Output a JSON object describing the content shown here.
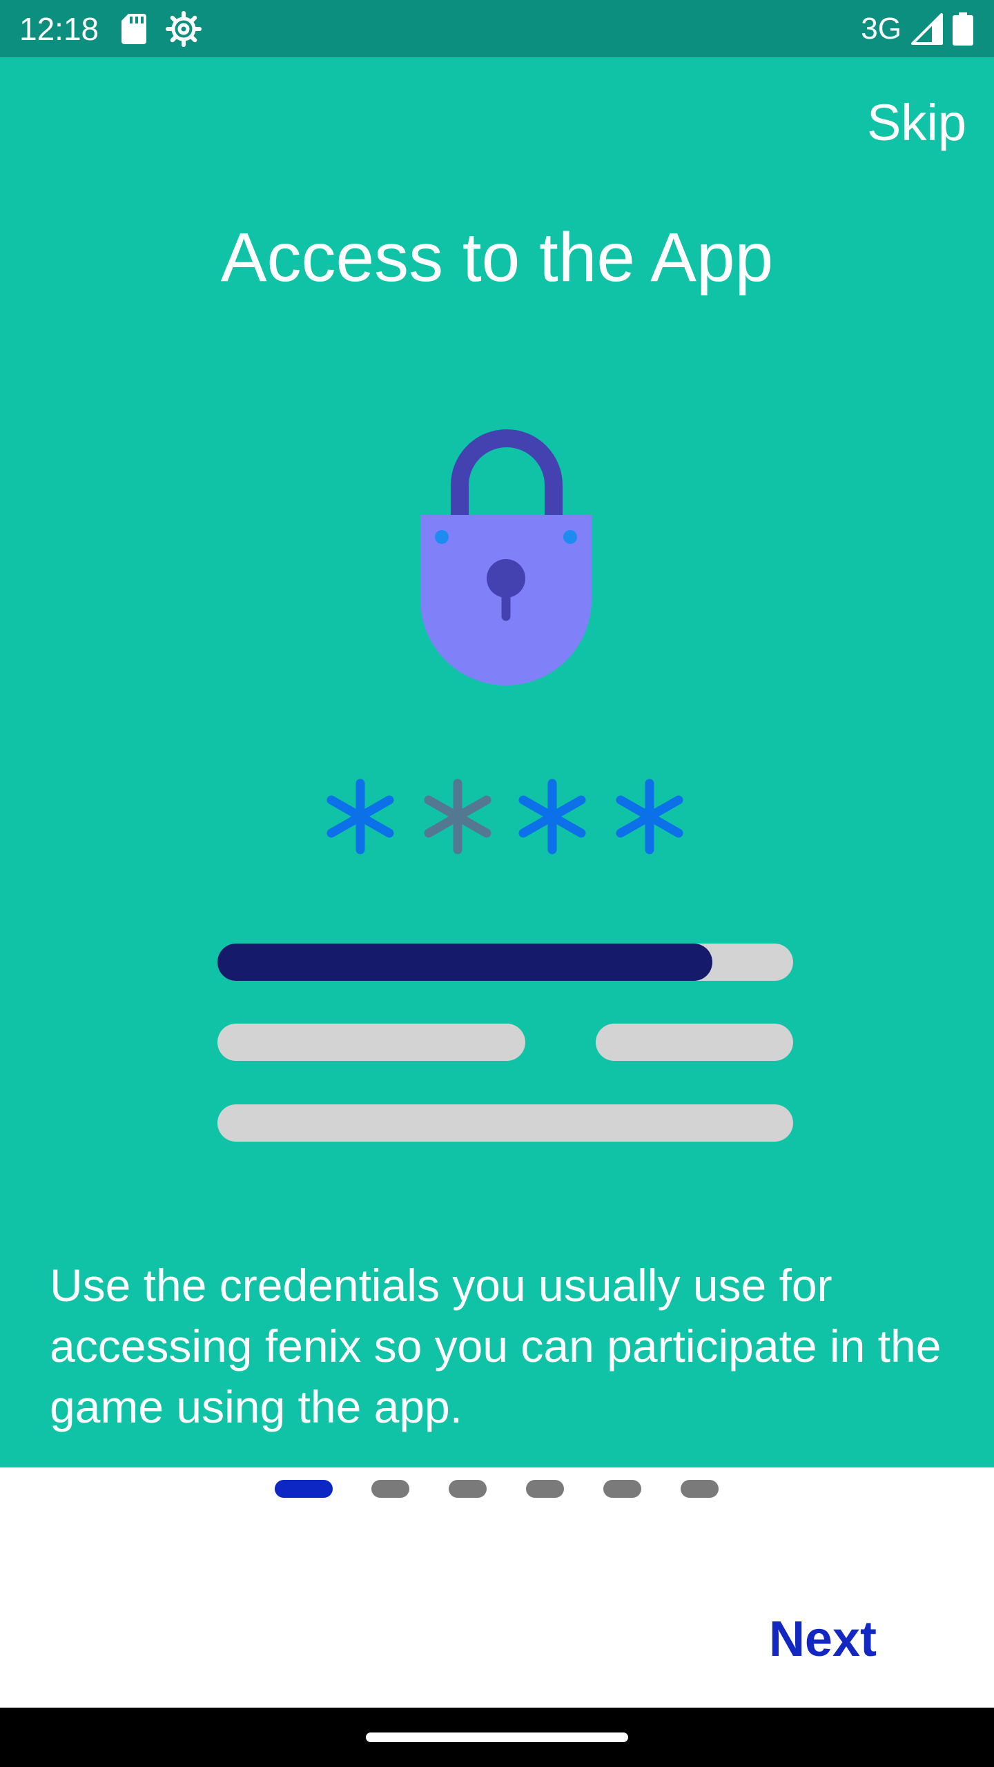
{
  "status_bar": {
    "time": "12:18",
    "left_icons": [
      "sd-card-icon",
      "settings-gear-icon"
    ],
    "network": "3G",
    "right_icons": [
      "signal-icon",
      "battery-icon"
    ]
  },
  "onboarding": {
    "skip_label": "Skip",
    "title": "Access to the App",
    "illustration_icons": [
      "padlock-icon",
      "asterisk-icon",
      "asterisk-icon",
      "asterisk-icon",
      "asterisk-icon"
    ],
    "password_strength_fraction": 0.86,
    "description": "Use the credentials you usually use for accessing fenix so you can participate in the game using the app.",
    "page_count": 6,
    "current_page": 1,
    "next_label": "Next"
  },
  "colors": {
    "status_bar_bg": "#0d8f7f",
    "main_bg": "#10c2a6",
    "lock_body": "#8080f8",
    "lock_shackle": "#4442b0",
    "asterisk_blue": "#0c70e8",
    "asterisk_gray": "#547892",
    "progress_fill": "#161a6a",
    "placeholder_bar": "#d3d3d3",
    "active_dot": "#0d27c4",
    "inactive_dot": "#7a7a7a",
    "next_text": "#1228c0"
  }
}
